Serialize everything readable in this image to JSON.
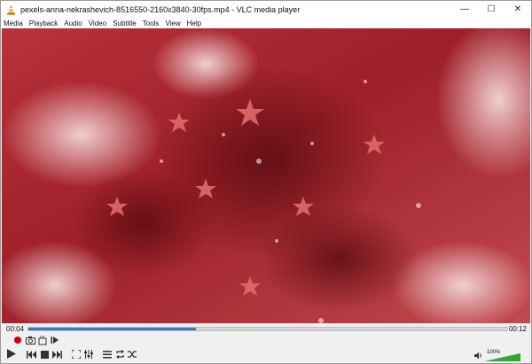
{
  "window": {
    "title": "pexels-anna-nekrashevich-8516550-2160x3840-30fps.mp4 - VLC media player",
    "controls": {
      "minimize": "—",
      "maximize": "☐",
      "close": "✕"
    }
  },
  "menu": [
    "Media",
    "Playback",
    "Audio",
    "Video",
    "Subtitle",
    "Tools",
    "View",
    "Help"
  ],
  "playback": {
    "elapsed": "00:04",
    "total": "00:12",
    "progress": 0.35
  },
  "volume": {
    "label": "100%",
    "level": 1.0
  },
  "colors": {
    "accent": "#3d79c4",
    "record": "#d10000",
    "volume": "#2fa82f",
    "vlc_orange": "#f08a00"
  },
  "icons": {
    "app": "vlc-cone-icon",
    "record": "record-icon",
    "snapshot": "camera-icon",
    "loop_ab": "loop-ab-icon",
    "frame_step": "frame-step-icon",
    "play": "play-icon",
    "prev": "previous-icon",
    "stop": "stop-icon",
    "next": "next-icon",
    "fullscreen": "fullscreen-icon",
    "ext_settings": "equalizer-icon",
    "playlist": "playlist-icon",
    "loop": "loop-icon",
    "shuffle": "shuffle-icon",
    "speaker": "speaker-icon"
  }
}
